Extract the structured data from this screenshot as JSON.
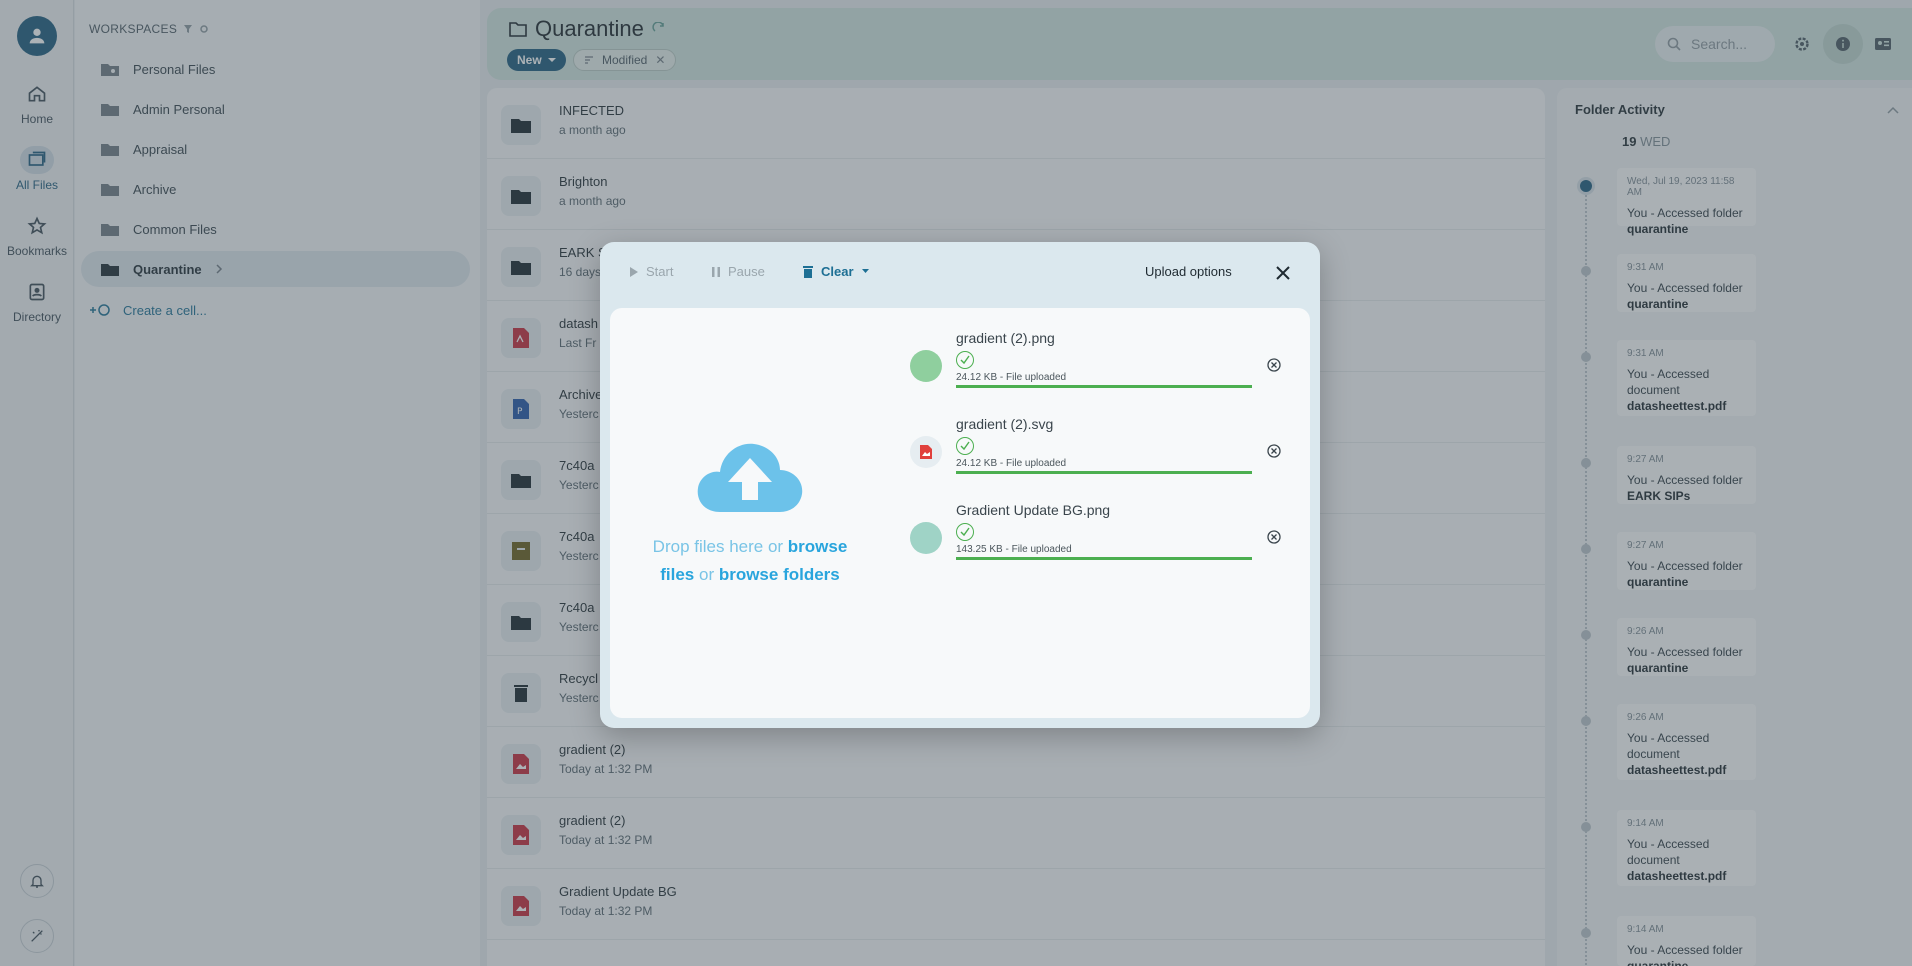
{
  "rail": {
    "items": [
      {
        "label": "Home"
      },
      {
        "label": "All Files"
      },
      {
        "label": "Bookmarks"
      },
      {
        "label": "Directory"
      }
    ]
  },
  "workspaces": {
    "heading": "WORKSPACES",
    "items": [
      {
        "label": "Personal Files"
      },
      {
        "label": "Admin Personal"
      },
      {
        "label": "Appraisal"
      },
      {
        "label": "Archive"
      },
      {
        "label": "Common Files"
      },
      {
        "label": "Quarantine"
      }
    ],
    "create_cell": "Create a cell..."
  },
  "header": {
    "title": "Quarantine",
    "new_label": "New",
    "sort_chip": "Modified",
    "search_placeholder": "Search..."
  },
  "files": [
    {
      "name": "INFECTED",
      "date": "a month ago",
      "icon": "folder-icon"
    },
    {
      "name": "Brighton",
      "date": "a month ago",
      "icon": "folder-icon"
    },
    {
      "name": "EARK S",
      "date": "16 days",
      "icon": "folder-icon"
    },
    {
      "name": "datash",
      "date": "Last Fr",
      "icon": "pdf-icon"
    },
    {
      "name": "Archive",
      "date": "Yesterc",
      "icon": "document-icon"
    },
    {
      "name": "7c40a",
      "date": "Yesterc",
      "icon": "folder-icon"
    },
    {
      "name": "7c40a",
      "date": "Yesterc",
      "icon": "archive-box-icon"
    },
    {
      "name": "7c40a",
      "date": "Yesterc",
      "icon": "folder-icon"
    },
    {
      "name": "Recycl",
      "date": "Yesterc",
      "icon": "trash-icon"
    },
    {
      "name": "gradient (2)",
      "date": "Today at 1:32 PM",
      "icon": "image-file-icon"
    },
    {
      "name": "gradient (2)",
      "date": "Today at 1:32 PM",
      "icon": "image-file-icon"
    },
    {
      "name": "Gradient Update BG",
      "date": "Today at 1:32 PM",
      "icon": "image-file-icon"
    }
  ],
  "activity": {
    "title": "Folder Activity",
    "day_num": "19",
    "day_name": "WED",
    "entries": [
      {
        "time": "Wed, Jul 19, 2023 11:58 AM",
        "text": "You - Accessed folder ",
        "target": "quarantine"
      },
      {
        "time": "9:31 AM",
        "text": "You - Accessed folder ",
        "target": "quarantine"
      },
      {
        "time": "9:31 AM",
        "text": "You - Accessed document ",
        "target": "datasheettest.pdf"
      },
      {
        "time": "9:27 AM",
        "text": "You - Accessed folder ",
        "target": "EARK SIPs"
      },
      {
        "time": "9:27 AM",
        "text": "You - Accessed folder ",
        "target": "quarantine"
      },
      {
        "time": "9:26 AM",
        "text": "You - Accessed folder ",
        "target": "quarantine"
      },
      {
        "time": "9:26 AM",
        "text": "You - Accessed document ",
        "target": "datasheettest.pdf"
      },
      {
        "time": "9:14 AM",
        "text": "You - Accessed document ",
        "target": "datasheettest.pdf"
      },
      {
        "time": "9:14 AM",
        "text": "You - Accessed folder ",
        "target": "quarantine"
      }
    ]
  },
  "upload": {
    "start": "Start",
    "pause": "Pause",
    "clear": "Clear",
    "options": "Upload options",
    "drop_1": "Drop files here or ",
    "browse_files_1": "browse",
    "browse_files_2": "files",
    "or": " or ",
    "browse_folders": "browse folders",
    "items": [
      {
        "name": "gradient (2).png",
        "meta": "24.12 KB - File uploaded",
        "progress": 1.0,
        "thumb_color": "#8fcf9e"
      },
      {
        "name": "gradient (2).svg",
        "meta": "24.12 KB - File uploaded",
        "progress": 1.0,
        "thumb_color": "#e6edf1"
      },
      {
        "name": "Gradient Update BG.png",
        "meta": "143.25 KB - File uploaded",
        "progress": 1.0,
        "thumb_color": "#9fd3c6"
      }
    ]
  },
  "colors": {
    "accent": "#1d5a7c",
    "link": "#29a5dd",
    "success": "#4caf50"
  }
}
